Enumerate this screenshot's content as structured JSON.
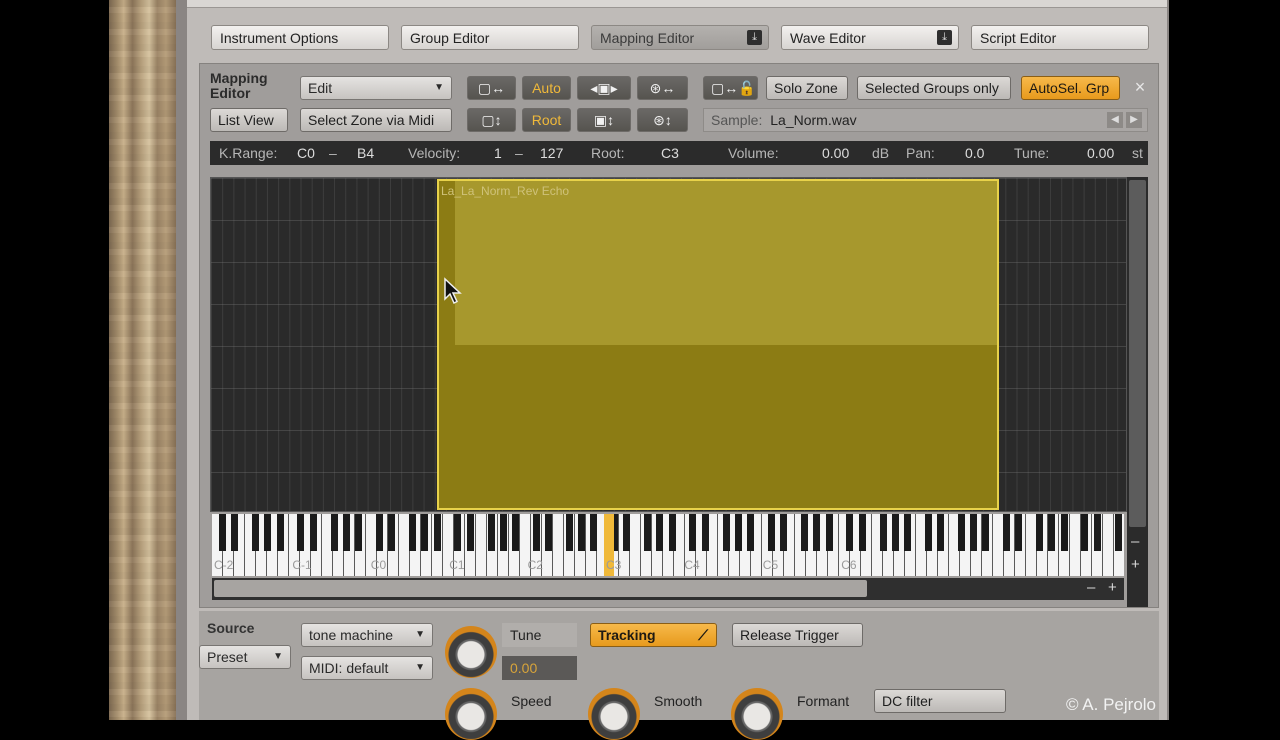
{
  "tabs": {
    "instrument_options": "Instrument Options",
    "group_editor": "Group Editor",
    "mapping_editor": "Mapping Editor",
    "wave_editor": "Wave Editor",
    "script_editor": "Script Editor"
  },
  "mapping": {
    "title_line1": "Mapping",
    "title_line2": "Editor",
    "edit_menu": "Edit",
    "list_view": "List View",
    "select_zone_midi": "Select Zone via Midi",
    "auto": "Auto",
    "root": "Root",
    "solo_zone": "Solo Zone",
    "selected_groups_only": "Selected Groups only",
    "autosel_grp": "AutoSel. Grp",
    "close": "×",
    "sample_label": "Sample:",
    "sample_value": "La_Norm.wav"
  },
  "infobar": {
    "krange_label": "K.Range:",
    "krange_low": "C0",
    "dash1": "–",
    "krange_high": "B4",
    "velocity_label": "Velocity:",
    "vel_low": "1",
    "dash2": "–",
    "vel_high": "127",
    "root_label": "Root:",
    "root_value": "C3",
    "volume_label": "Volume:",
    "volume_value": "0.00",
    "volume_unit": "dB",
    "pan_label": "Pan:",
    "pan_value": "0.0",
    "tune_label": "Tune:",
    "tune_value": "0.00",
    "tune_unit": "st"
  },
  "zone": {
    "label": "La_La_Norm_Rev Echo"
  },
  "keyboard": {
    "labels": [
      "C-2",
      "C-1",
      "C0",
      "C1",
      "C2",
      "C3",
      "C4",
      "C5",
      "C6"
    ],
    "highlight_color": "#f0b93a"
  },
  "zoom": {
    "minus": "–",
    "plus": "+"
  },
  "source": {
    "title": "Source",
    "mode": "Preset",
    "machine": "tone machine",
    "midi": "MIDI: default",
    "tune_label": "Tune",
    "tune_value": "0.00",
    "tracking": "Tracking",
    "release_trigger": "Release Trigger",
    "speed_label": "Speed",
    "smooth_label": "Smooth",
    "formant_label": "Formant",
    "dc_filter": "DC filter"
  },
  "watermark": "© A. Pejrolo",
  "accent_color": "#e99e22"
}
